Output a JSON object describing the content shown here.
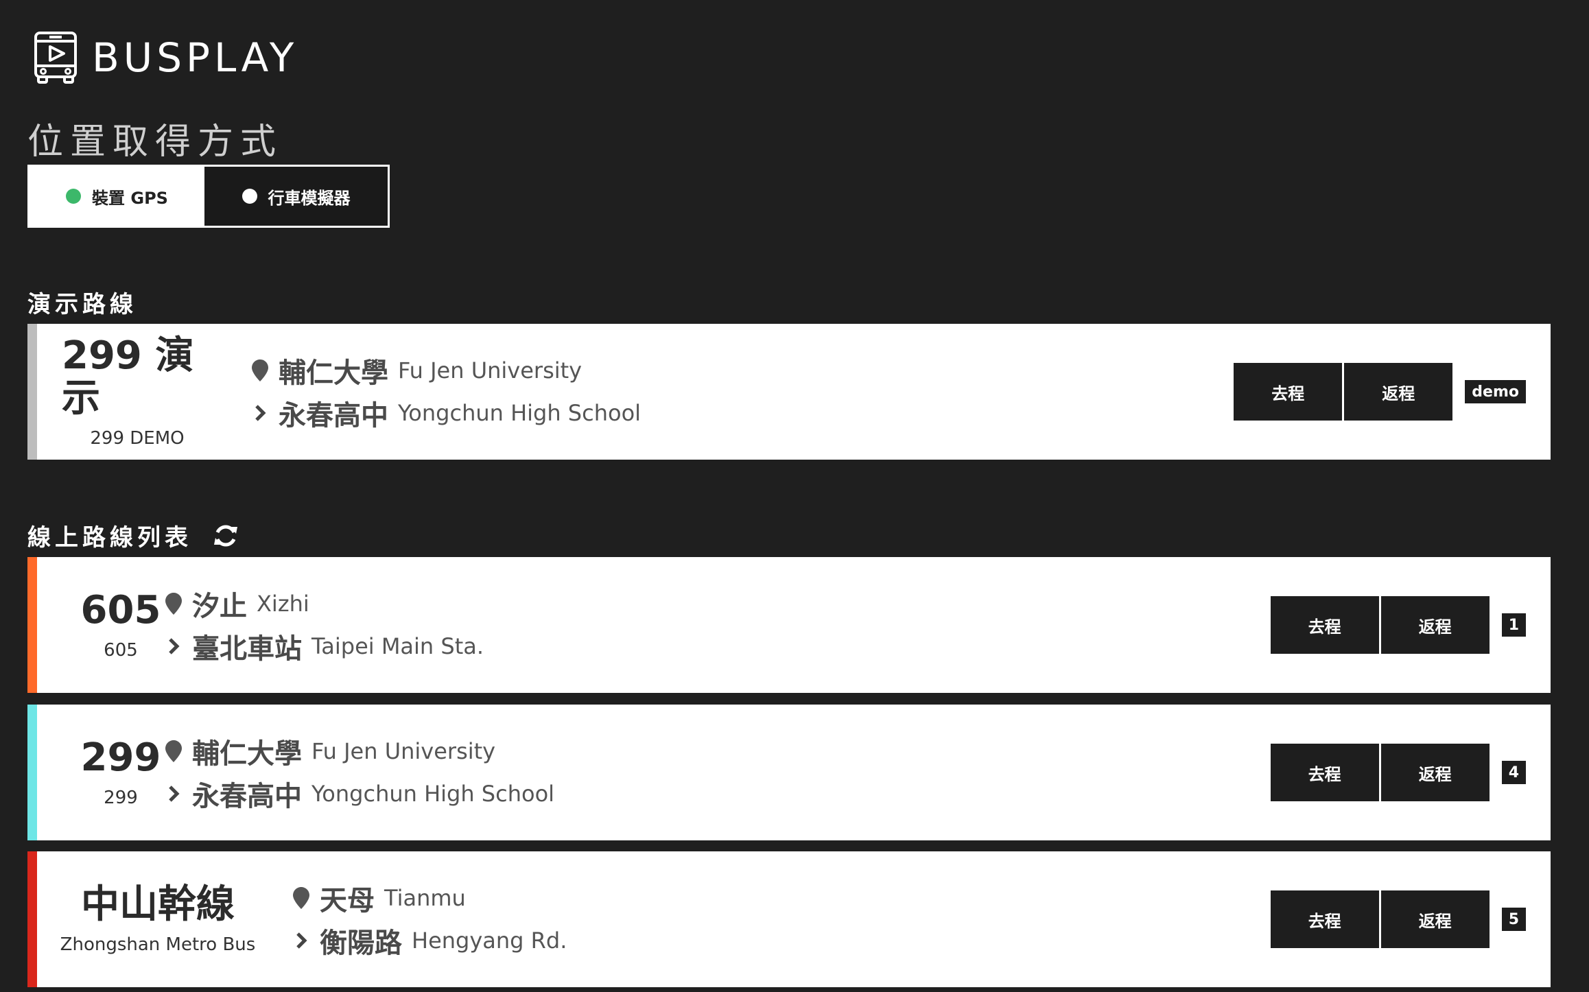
{
  "app": {
    "name": "BUSPLAY"
  },
  "location": {
    "title": "位置取得方式",
    "options": [
      {
        "label": "裝置 GPS",
        "dot_color": "#3cb86a"
      },
      {
        "label": "行車模擬器",
        "dot_color": "#ffffff"
      }
    ]
  },
  "demo_section": {
    "heading": "演示路線",
    "route": {
      "name": "299 演示",
      "subname": "299 DEMO",
      "stripe_color": "#bdbdbd",
      "from_zh": "輔仁大學",
      "from_en": "Fu Jen University",
      "to_zh": "永春高中",
      "to_en": "Yongchun High School",
      "go_label": "去程",
      "back_label": "返程",
      "badge": "demo"
    }
  },
  "online_section": {
    "heading": "線上路線列表",
    "routes": [
      {
        "name": "605",
        "subname": "605",
        "stripe_color": "#ff6a2a",
        "from_zh": "汐止",
        "from_en": "Xizhi",
        "to_zh": "臺北車站",
        "to_en": "Taipei Main Sta.",
        "go_label": "去程",
        "back_label": "返程",
        "badge": "1"
      },
      {
        "name": "299",
        "subname": "299",
        "stripe_color": "#6ee6e6",
        "from_zh": "輔仁大學",
        "from_en": "Fu Jen University",
        "to_zh": "永春高中",
        "to_en": "Yongchun High School",
        "go_label": "去程",
        "back_label": "返程",
        "badge": "4"
      },
      {
        "name": "中山幹線",
        "subname": "Zhongshan Metro Bus",
        "stripe_color": "#d9271c",
        "from_zh": "天母",
        "from_en": "Tianmu",
        "to_zh": "衡陽路",
        "to_en": "Hengyang Rd.",
        "go_label": "去程",
        "back_label": "返程",
        "badge": "5"
      }
    ]
  }
}
